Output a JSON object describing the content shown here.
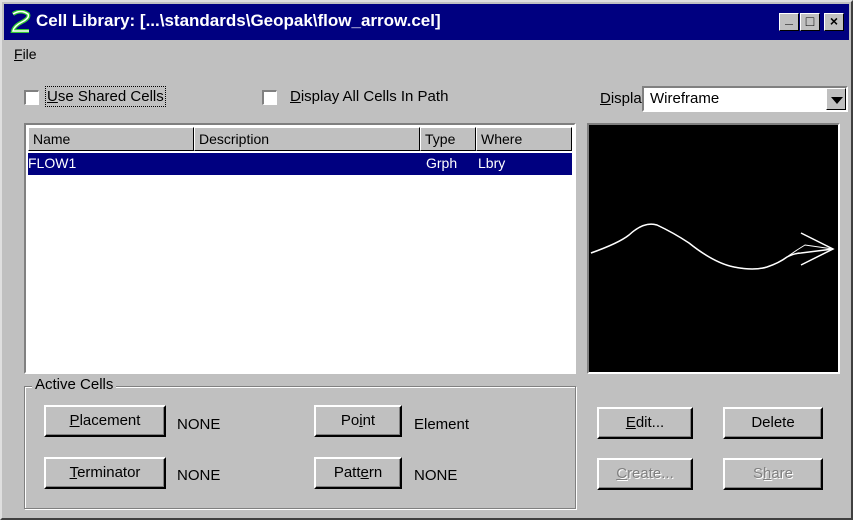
{
  "window": {
    "title": "Cell Library: [...\\standards\\Geopak\\flow_arrow.cel]",
    "controls": {
      "minimize": "_",
      "maximize": "□",
      "close": "×"
    }
  },
  "menu": {
    "items": [
      {
        "label": "File",
        "accel": "F",
        "rest": "ile"
      }
    ]
  },
  "options": {
    "use_shared_cells": {
      "label": "Use Shared Cells",
      "accel": "U",
      "rest": "se Shared Cells",
      "checked": false
    },
    "display_all_cells": {
      "label": "Display All Cells In Path",
      "accel": "D",
      "rest": "isplay All Cells In Path",
      "checked": false
    }
  },
  "display": {
    "label": "Display:",
    "accel": "D",
    "rest": "isplay:",
    "value": "Wireframe"
  },
  "cell_list": {
    "columns": [
      "Name",
      "Description",
      "Type",
      "Where"
    ],
    "rows": [
      {
        "name": "FLOW1",
        "description": "",
        "type": "Grph",
        "where": "Lbry",
        "selected": true
      }
    ]
  },
  "preview": {
    "icon": "flow-arrow-wireframe",
    "background": "#000000",
    "stroke": "#ffffff"
  },
  "active_cells": {
    "title": "Active Cells",
    "placement": {
      "label": "Placement",
      "accel": "P",
      "rest": "lacement",
      "value": "NONE"
    },
    "terminator": {
      "label": "Terminator",
      "accel": "T",
      "rest": "erminator",
      "value": "NONE"
    },
    "point": {
      "label": "Point",
      "pre": "Po",
      "accel": "i",
      "rest": "nt",
      "value": "Element"
    },
    "pattern": {
      "label": "Pattern",
      "pre": "Patt",
      "accel": "e",
      "rest": "rn",
      "value": "NONE"
    }
  },
  "actions": {
    "edit": {
      "label": "Edit...",
      "accel": "E",
      "rest": "dit..."
    },
    "delete": {
      "label": "Delete"
    },
    "create": {
      "label": "Create...",
      "accel": "C",
      "rest": "reate...",
      "enabled": false
    },
    "share": {
      "label": "Share",
      "pre": "S",
      "accel": "h",
      "rest": "are",
      "enabled": false
    }
  },
  "colors": {
    "titlebar": "#000080",
    "face": "#c0c0c0",
    "selection": "#000080"
  }
}
